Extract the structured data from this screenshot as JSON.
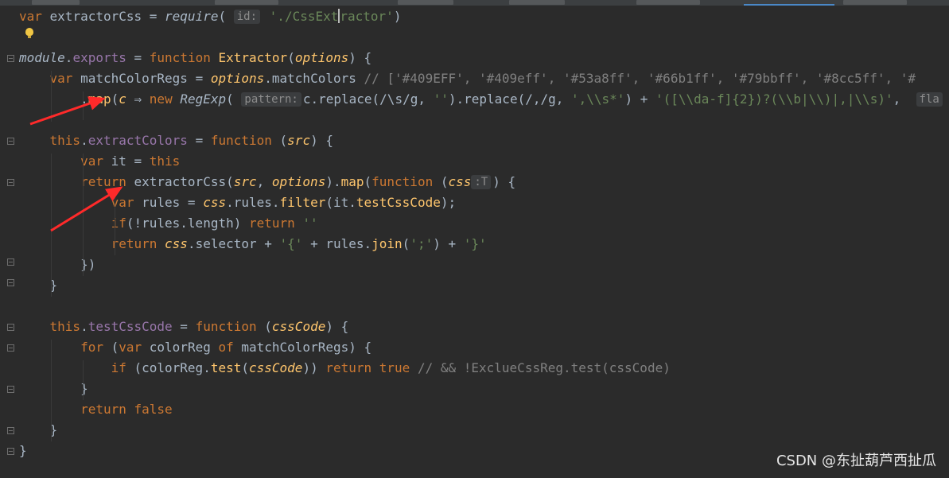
{
  "editor": {
    "lines": [
      {
        "segments": [
          {
            "t": "var",
            "c": "k"
          },
          {
            "t": " extractorCss = "
          },
          {
            "t": "require",
            "c": "fi"
          },
          {
            "t": "( "
          },
          {
            "t": "id:",
            "c": "hint"
          },
          {
            "t": " "
          },
          {
            "t": "'./CssExt",
            "c": "s"
          },
          {
            "t": "",
            "c": "caret"
          },
          {
            "t": "ractor'",
            "c": "s"
          },
          {
            "t": ")"
          }
        ]
      },
      {
        "segments": []
      },
      {
        "segments": [
          {
            "t": "module",
            "c": "fi"
          },
          {
            "t": "."
          },
          {
            "t": "exports",
            "c": "m"
          },
          {
            "t": " = "
          },
          {
            "t": "function",
            "c": "k"
          },
          {
            "t": " "
          },
          {
            "t": "Extractor",
            "c": "f"
          },
          {
            "t": "("
          },
          {
            "t": "options",
            "c": "p"
          },
          {
            "t": ") {"
          }
        ]
      },
      {
        "segments": [
          {
            "t": "    "
          },
          {
            "t": "var",
            "c": "k"
          },
          {
            "t": " matchColorRegs = "
          },
          {
            "t": "options",
            "c": "p"
          },
          {
            "t": ".matchColors "
          },
          {
            "t": "// ['#409EFF', '#409eff', '#53a8ff', '#66b1ff', '#79bbff', '#8cc5ff', '#",
            "c": "c"
          }
        ]
      },
      {
        "segments": [
          {
            "t": "        ."
          },
          {
            "t": "map",
            "c": "f"
          },
          {
            "t": "("
          },
          {
            "t": "c",
            "c": "p"
          },
          {
            "t": " ⇒ "
          },
          {
            "t": "new",
            "c": "k"
          },
          {
            "t": " "
          },
          {
            "t": "RegExp",
            "c": "fi"
          },
          {
            "t": "( "
          },
          {
            "t": "pattern:",
            "c": "hint"
          },
          {
            "t": "c.replace(/\\s/g, "
          },
          {
            "t": "''",
            "c": "s"
          },
          {
            "t": ").replace(/,/g, "
          },
          {
            "t": "',\\\\s*'",
            "c": "s"
          },
          {
            "t": ") + "
          },
          {
            "t": "'([\\\\da-f]{2})?(\\\\b|\\\\)|,|\\\\s)'",
            "c": "s"
          },
          {
            "t": ",  "
          },
          {
            "t": "fla",
            "c": "hint"
          }
        ]
      },
      {
        "segments": []
      },
      {
        "segments": [
          {
            "t": "    "
          },
          {
            "t": "this",
            "c": "k"
          },
          {
            "t": "."
          },
          {
            "t": "extractColors",
            "c": "m"
          },
          {
            "t": " = "
          },
          {
            "t": "function",
            "c": "k"
          },
          {
            "t": " ("
          },
          {
            "t": "src",
            "c": "p"
          },
          {
            "t": ") {"
          }
        ]
      },
      {
        "segments": [
          {
            "t": "        "
          },
          {
            "t": "var",
            "c": "k"
          },
          {
            "t": " it = "
          },
          {
            "t": "this",
            "c": "k"
          }
        ]
      },
      {
        "segments": [
          {
            "t": "        "
          },
          {
            "t": "return",
            "c": "k"
          },
          {
            "t": " extractorCss("
          },
          {
            "t": "src",
            "c": "p"
          },
          {
            "t": ", "
          },
          {
            "t": "options",
            "c": "p"
          },
          {
            "t": ")."
          },
          {
            "t": "map",
            "c": "f"
          },
          {
            "t": "("
          },
          {
            "t": "function",
            "c": "k"
          },
          {
            "t": " ("
          },
          {
            "t": "css",
            "c": "p"
          },
          {
            "t": ":T",
            "c": "hint"
          },
          {
            "t": ") {"
          }
        ]
      },
      {
        "segments": [
          {
            "t": "            "
          },
          {
            "t": "var",
            "c": "k"
          },
          {
            "t": " rules = "
          },
          {
            "t": "css",
            "c": "p"
          },
          {
            "t": ".rules."
          },
          {
            "t": "filter",
            "c": "f"
          },
          {
            "t": "(it."
          },
          {
            "t": "testCssCode",
            "c": "f"
          },
          {
            "t": ");"
          }
        ]
      },
      {
        "segments": [
          {
            "t": "            "
          },
          {
            "t": "if",
            "c": "k"
          },
          {
            "t": "(!rules.length) "
          },
          {
            "t": "return",
            "c": "k"
          },
          {
            "t": " "
          },
          {
            "t": "''",
            "c": "s"
          }
        ]
      },
      {
        "segments": [
          {
            "t": "            "
          },
          {
            "t": "return",
            "c": "k"
          },
          {
            "t": " "
          },
          {
            "t": "css",
            "c": "p"
          },
          {
            "t": ".selector + "
          },
          {
            "t": "'{'",
            "c": "s"
          },
          {
            "t": " + rules."
          },
          {
            "t": "join",
            "c": "f"
          },
          {
            "t": "("
          },
          {
            "t": "';'",
            "c": "s"
          },
          {
            "t": ") + "
          },
          {
            "t": "'}'",
            "c": "s"
          }
        ]
      },
      {
        "segments": [
          {
            "t": "        })"
          }
        ]
      },
      {
        "segments": [
          {
            "t": "    }"
          }
        ]
      },
      {
        "segments": []
      },
      {
        "segments": [
          {
            "t": "    "
          },
          {
            "t": "this",
            "c": "k"
          },
          {
            "t": "."
          },
          {
            "t": "testCssCode",
            "c": "m"
          },
          {
            "t": " = "
          },
          {
            "t": "function",
            "c": "k"
          },
          {
            "t": " ("
          },
          {
            "t": "cssCode",
            "c": "p"
          },
          {
            "t": ") {"
          }
        ]
      },
      {
        "segments": [
          {
            "t": "        "
          },
          {
            "t": "for",
            "c": "k"
          },
          {
            "t": " ("
          },
          {
            "t": "var",
            "c": "k"
          },
          {
            "t": " colorReg "
          },
          {
            "t": "of",
            "c": "k"
          },
          {
            "t": " matchColorRegs) {"
          }
        ]
      },
      {
        "segments": [
          {
            "t": "            "
          },
          {
            "t": "if",
            "c": "k"
          },
          {
            "t": " (colorReg."
          },
          {
            "t": "test",
            "c": "f"
          },
          {
            "t": "("
          },
          {
            "t": "cssCode",
            "c": "p"
          },
          {
            "t": ")) "
          },
          {
            "t": "return",
            "c": "k"
          },
          {
            "t": " "
          },
          {
            "t": "true",
            "c": "k"
          },
          {
            "t": " "
          },
          {
            "t": "// && !ExclueCssReg.test(cssCode)",
            "c": "c"
          }
        ]
      },
      {
        "segments": [
          {
            "t": "        }"
          }
        ]
      },
      {
        "segments": [
          {
            "t": "        "
          },
          {
            "t": "return",
            "c": "k"
          },
          {
            "t": " "
          },
          {
            "t": "false",
            "c": "k"
          }
        ]
      },
      {
        "segments": [
          {
            "t": "    }"
          }
        ]
      },
      {
        "segments": [
          {
            "t": "}"
          }
        ]
      }
    ]
  },
  "watermark": "CSDN @东扯葫芦西扯瓜",
  "colors": {
    "background": "#2b2b2b",
    "keyword": "#cc7832",
    "string": "#6a8759",
    "comment": "#808080",
    "arrow": "#ff2a2a"
  }
}
